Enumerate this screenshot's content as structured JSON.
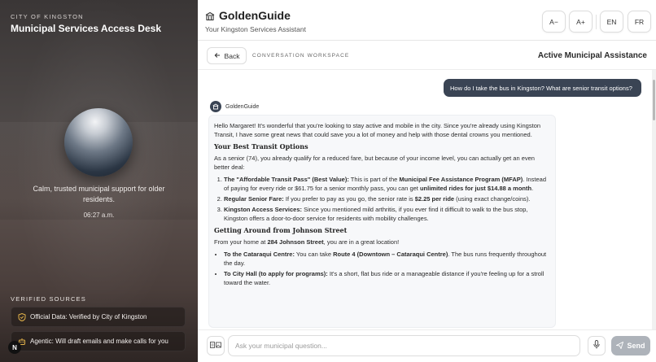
{
  "left": {
    "city_label": "CITY OF KINGSTON",
    "title": "Municipal Services Access Desk",
    "tagline": "Calm, trusted municipal support for older residents.",
    "time": "06:27 a.m.",
    "verified_heading": "VERIFIED SOURCES",
    "sources": [
      {
        "icon": "shield-check-icon",
        "label": "Official Data: Verified by City of Kingston"
      },
      {
        "icon": "robot-icon",
        "label": "Agentic: Will draft emails and make calls for you"
      }
    ],
    "logo_letter": "N"
  },
  "header": {
    "brand": "GoldenGuide",
    "subtitle": "Your Kingston Services Assistant",
    "font_smaller": "A−",
    "font_larger": "A+",
    "lang_en": "EN",
    "lang_fr": "FR"
  },
  "subbar": {
    "back": "Back",
    "workspace": "CONVERSATION WORKSPACE",
    "status": "Active Municipal Assistance"
  },
  "chat": {
    "user_message": "How do I take the bus in Kingston? What are senior transit options?",
    "bot_name": "GoldenGuide",
    "intro": "Hello Margaret! It's wonderful that you're looking to stay active and mobile in the city. Since you're already using Kingston Transit, I have some great news that could save you a lot of money and help with those dental crowns you mentioned.",
    "h1": "Your Best Transit Options",
    "p1": "As a senior (74), you already qualify for a reduced fare, but because of your income level, you can actually get an even better deal:",
    "opt1_b": "The \"Affordable Transit Pass\" (Best Value):",
    "opt1_t1": " This is part of the ",
    "opt1_b2": "Municipal Fee Assistance Program (MFAP)",
    "opt1_t2": ". Instead of paying for every ride or $61.75 for a senior monthly pass, you can get ",
    "opt1_b3": "unlimited rides for just $14.88 a month",
    "opt1_t3": ".",
    "opt2_b": "Regular Senior Fare:",
    "opt2_t1": " If you prefer to pay as you go, the senior rate is ",
    "opt2_b2": "$2.25 per ride",
    "opt2_t2": " (using exact change/coins).",
    "opt3_b": "Kingston Access Services:",
    "opt3_t": " Since you mentioned mild arthritis, if you ever find it difficult to walk to the bus stop, Kingston offers a door-to-door service for residents with mobility challenges.",
    "h2": "Getting Around from Johnson Street",
    "p2_t1": "From your home at ",
    "p2_b": "284 Johnson Street",
    "p2_t2": ", you are in a great location!",
    "b1_b": "To the Cataraqui Centre:",
    "b1_t1": " You can take ",
    "b1_b2": "Route 4 (Downtown – Cataraqui Centre)",
    "b1_t2": ". The bus runs frequently throughout the day.",
    "b2_b": "To City Hall (to apply for programs):",
    "b2_t": " It's a short, flat bus ride or a manageable distance if you're feeling up for a stroll toward the water."
  },
  "input": {
    "placeholder": "Ask your municipal question...",
    "send": "Send"
  },
  "colors": {
    "user_bubble": "#3a4454",
    "accent_gold": "#e3b34a",
    "send_disabled": "#aeb3ba"
  }
}
